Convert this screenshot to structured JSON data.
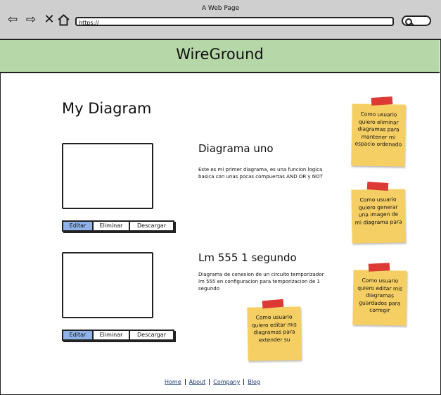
{
  "browser": {
    "title": "A Web Page",
    "url": "https://",
    "nav_icons": [
      "back-arrow-icon",
      "forward-arrow-icon",
      "close-x-icon",
      "home-icon"
    ]
  },
  "header": {
    "title": "WireGround"
  },
  "page": {
    "title": "My Diagram"
  },
  "diagrams": [
    {
      "title": "Diagrama uno",
      "description": "Este es mi primer diagrama, es una funcion logica basica con unas pocas compuertas AND OR y NOT",
      "buttons": {
        "edit": "Editar",
        "delete": "Eliminar",
        "download": "Descargar"
      }
    },
    {
      "title": "Lm 555 1 segundo",
      "description": "Diagrama de conexion de un circuito temporizador lm 555 en configuracion para temporizacion de 1 segundo",
      "buttons": {
        "edit": "Editar",
        "delete": "Eliminar",
        "download": "Descargar"
      }
    }
  ],
  "notes": [
    "Como usuario quiero eliminar diagramas para mantener mi espacio ordenado",
    "Como usuario quiero generar una imagen de mi diagrama para",
    "Como usuario quiero editar mis diagramas guardados para corregir",
    "Como usuario quiero editar mis diagramas para extender su"
  ],
  "footer": {
    "links": [
      "Home",
      "About",
      "Company",
      "Blog"
    ]
  },
  "colors": {
    "header_bg": "#b6d7a8",
    "note_bg": "#f5cf63",
    "tape": "#dd3a35",
    "active_button": "#8fb3e8",
    "link": "#1b3a74"
  }
}
